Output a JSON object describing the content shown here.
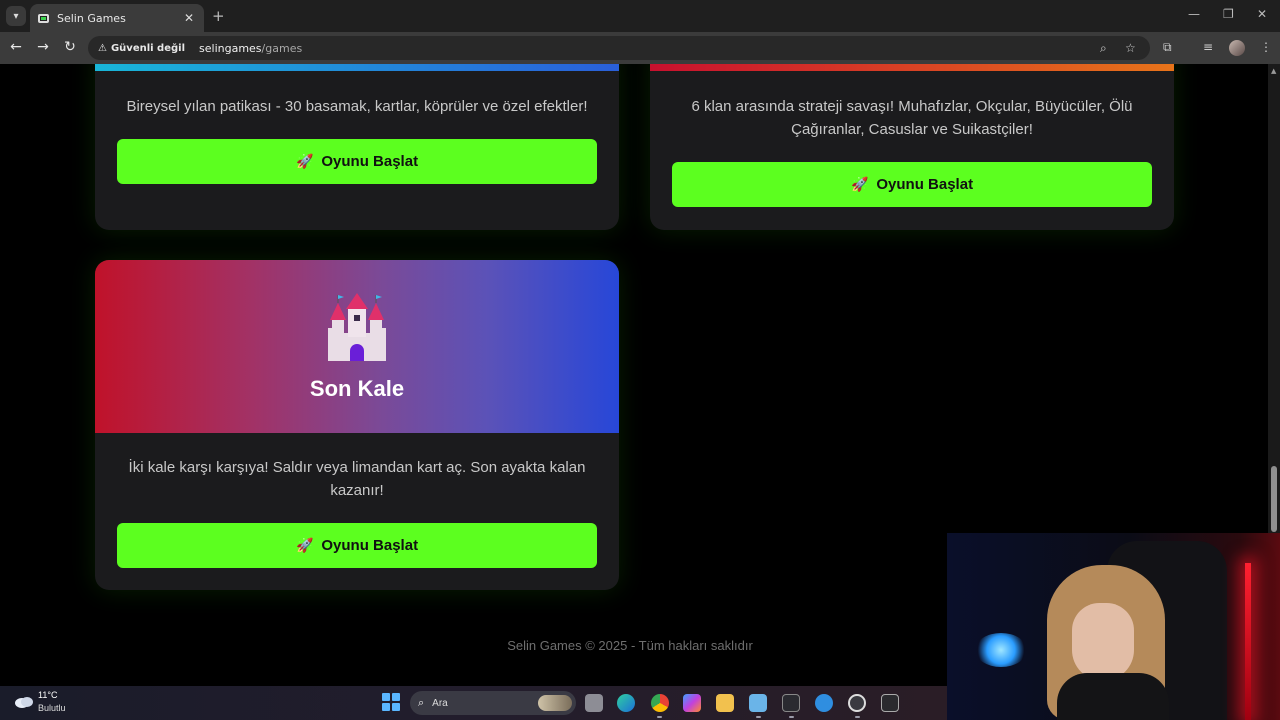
{
  "browser": {
    "tab_title": "Selin Games",
    "tab_close": "✕",
    "new_tab": "+",
    "security_label": "Güvenli değil",
    "url_host": "selingames",
    "url_path": "/games",
    "window_controls": {
      "minimize": "—",
      "restore": "❐",
      "close": "✕"
    }
  },
  "games": [
    {
      "description": "Bireysel yılan patikası - 30 basamak, kartlar, köprüler ve özel efektler!",
      "button_label": "Oyunu Başlat",
      "button_icon": "🚀",
      "accent_gradient": [
        "#19b6d8",
        "#2a5fd8"
      ]
    },
    {
      "description": "6 klan arasında strateji savaşı! Muhafızlar, Okçular, Büyücüler, Ölü Çağıranlar, Casuslar ve Suikastçiler!",
      "button_label": "Oyunu Başlat",
      "button_icon": "🚀",
      "accent_gradient": [
        "#c8102e",
        "#e8741a"
      ]
    },
    {
      "title": "Son Kale",
      "icon": "castle-icon",
      "description": "İki kale karşı karşıya! Saldır veya limandan kart aç. Son ayakta kalan kazanır!",
      "button_label": "Oyunu Başlat",
      "button_icon": "🚀",
      "accent_gradient": [
        "#c0122a",
        "#2747d8"
      ]
    }
  ],
  "footer": {
    "text": "Selin Games © 2025 - Tüm hakları saklıdır"
  },
  "taskbar": {
    "weather_temp": "11°C",
    "weather_condition": "Bulutlu",
    "search_placeholder": "Ara"
  },
  "colors": {
    "play_button": "#5cff1f",
    "card_bg": "#1b1b1d",
    "page_bg": "#000000"
  }
}
